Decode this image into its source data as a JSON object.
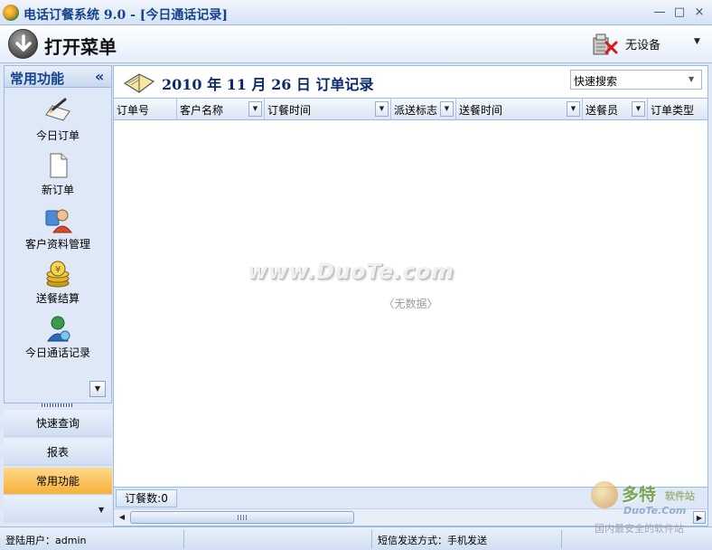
{
  "window": {
    "title": "电话订餐系统 9.0 - [今日通话记录]",
    "minimize": "—",
    "maximize": "□",
    "close": "×"
  },
  "toolbar": {
    "open_menu_label": "打开菜单",
    "device_label": "无设备"
  },
  "sidebar": {
    "title": "常用功能",
    "collapse_glyph": "«",
    "items": [
      {
        "label": "今日订单",
        "icon": "pen-paper-icon"
      },
      {
        "label": "新订单",
        "icon": "blank-document-icon"
      },
      {
        "label": "客户资料管理",
        "icon": "customers-icon"
      },
      {
        "label": "送餐结算",
        "icon": "coins-icon"
      },
      {
        "label": "今日通话记录",
        "icon": "call-person-icon"
      }
    ],
    "lower_nav": [
      {
        "label": "快速查询",
        "active": false
      },
      {
        "label": "报表",
        "active": false
      },
      {
        "label": "常用功能",
        "active": true
      }
    ]
  },
  "content": {
    "order_title": "2010 年 11 月 26 日 订单记录",
    "quick_search_value": "快速搜索",
    "columns": [
      "订单号",
      "客户名称",
      "订餐时间",
      "派送标志",
      "送餐时间",
      "送餐员",
      "订单类型"
    ],
    "no_data_text": "〈无数据〉",
    "watermark": "www.DuoTe.com",
    "order_count_label": "订餐数:0"
  },
  "statusbar": {
    "login_user": "登陆用户：admin",
    "empty_segment": "",
    "sms_mode": "短信发送方式：手机发送"
  },
  "corner_logo": {
    "main": "多特",
    "sub": "软件站",
    "url": "DuoTe.Com",
    "slogan": "国内最安全的软件站"
  },
  "colors": {
    "title_blue": "#15428b",
    "panel_bg": "#dfe8f6",
    "border_blue": "#99bbe8",
    "active_orange": "#f6b13a"
  }
}
